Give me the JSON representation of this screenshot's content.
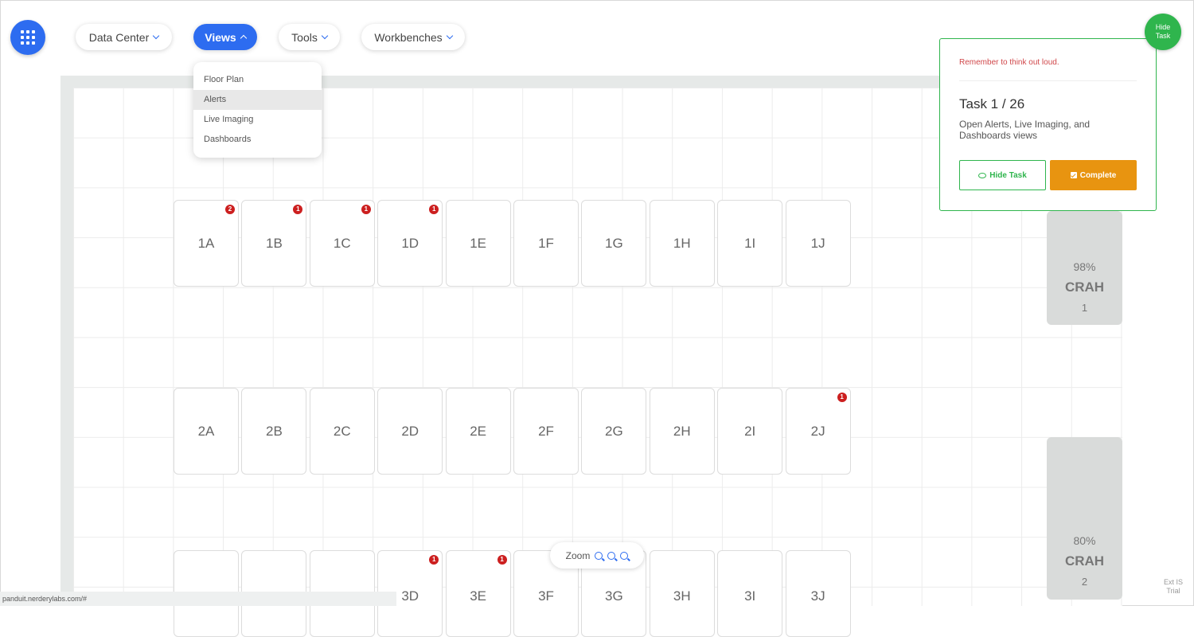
{
  "nav": {
    "items": [
      {
        "label": "Data Center"
      },
      {
        "label": "Views"
      },
      {
        "label": "Tools"
      },
      {
        "label": "Workbenches"
      }
    ]
  },
  "views_menu": {
    "items": [
      "Floor Plan",
      "Alerts",
      "Live Imaging",
      "Dashboards"
    ],
    "hovered": "Alerts"
  },
  "racks": {
    "row1": [
      {
        "label": "1A",
        "alerts": "2"
      },
      {
        "label": "1B",
        "alerts": "1"
      },
      {
        "label": "1C",
        "alerts": "1"
      },
      {
        "label": "1D",
        "alerts": "1"
      },
      {
        "label": "1E",
        "alerts": null
      },
      {
        "label": "1F",
        "alerts": null
      },
      {
        "label": "1G",
        "alerts": null
      },
      {
        "label": "1H",
        "alerts": null
      },
      {
        "label": "1I",
        "alerts": null
      },
      {
        "label": "1J",
        "alerts": null
      }
    ],
    "row2": [
      {
        "label": "2A",
        "alerts": null
      },
      {
        "label": "2B",
        "alerts": null
      },
      {
        "label": "2C",
        "alerts": null
      },
      {
        "label": "2D",
        "alerts": null
      },
      {
        "label": "2E",
        "alerts": null
      },
      {
        "label": "2F",
        "alerts": null
      },
      {
        "label": "2G",
        "alerts": null
      },
      {
        "label": "2H",
        "alerts": null
      },
      {
        "label": "2I",
        "alerts": null
      },
      {
        "label": "2J",
        "alerts": "1"
      }
    ],
    "row3": [
      {
        "label": "",
        "alerts": null
      },
      {
        "label": "",
        "alerts": null
      },
      {
        "label": "",
        "alerts": null
      },
      {
        "label": "3D",
        "alerts": "1"
      },
      {
        "label": "3E",
        "alerts": "1"
      },
      {
        "label": "3F",
        "alerts": null
      },
      {
        "label": "3G",
        "alerts": null
      },
      {
        "label": "3H",
        "alerts": null
      },
      {
        "label": "3I",
        "alerts": null
      },
      {
        "label": "3J",
        "alerts": null
      }
    ]
  },
  "crah": [
    {
      "pct": "98%",
      "name": "CRAH",
      "num": "1"
    },
    {
      "pct": "80%",
      "name": "CRAH",
      "num": "2"
    }
  ],
  "task": {
    "reminder": "Remember to think out loud.",
    "title": "Task 1 / 26",
    "description": "Open Alerts, Live Imaging, and Dashboards views",
    "hide_label": "Hide Task",
    "complete_label": "Complete",
    "circle_line1": "Hide",
    "circle_line2": "Task"
  },
  "zoom": {
    "label": "Zoom"
  },
  "status": {
    "url": "panduit.nerderylabs.com/#"
  },
  "corner": {
    "line1": "Ext IS",
    "line2": "Trial"
  },
  "colors": {
    "accent": "#2d6cf0",
    "task_green": "#2fb54d",
    "complete_orange": "#e89410",
    "alert_red": "#cc1f1f"
  }
}
